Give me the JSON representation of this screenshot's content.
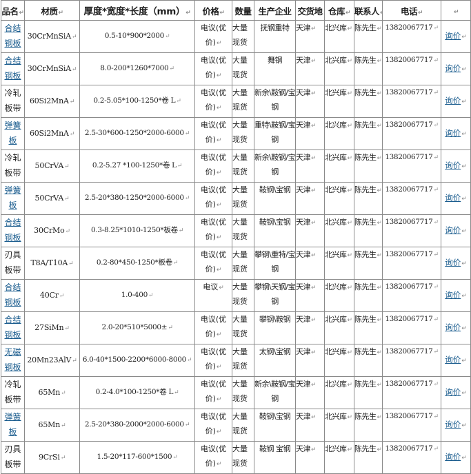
{
  "headers": {
    "name": "品名",
    "material": "材质",
    "size": "厚度*宽度*长度（mm）",
    "price": "价格",
    "qty": "数量",
    "maker": "生产企业",
    "place": "交货地",
    "warehouse": "仓库",
    "contact": "联系人",
    "phone": "电话"
  },
  "rows": [
    {
      "name": "合结钢板",
      "link": true,
      "material": "30CrMnSiA",
      "size": "0.5-10*900*2000",
      "price": "电议(优价)",
      "qty": "大量现货",
      "maker": "抚钢重特",
      "place": "天津",
      "warehouse": "北兴库",
      "contact": "陈先生",
      "phone": "13820067717",
      "inquiry": "询价"
    },
    {
      "name": "合结钢板",
      "link": true,
      "material": "30CrMnSiA",
      "size": "8.0-200*1260*7000",
      "price": "电议(优价)",
      "qty": "大量现货",
      "maker": "舞钢",
      "place": "天津",
      "warehouse": "北兴库",
      "contact": "陈先生",
      "phone": "13820067717",
      "inquiry": "询价"
    },
    {
      "name": "冷轧板带",
      "link": false,
      "material": "60Si2MnA",
      "size": "0.2-5.05*100-1250*卷 L",
      "price": "电议(优价)",
      "qty": "大量现货",
      "maker": "新余\\鞍钢/宝钢",
      "place": "天津",
      "warehouse": "北兴库",
      "contact": "陈先生",
      "phone": "13820067717",
      "inquiry": "询价"
    },
    {
      "name": "弹簧板",
      "link": true,
      "material": "60Si2MnA",
      "size": "2.5-30*600-1250*2000-6000",
      "price": "电议(优价)",
      "qty": "大量现货",
      "maker": "重特\\鞍钢/宝钢",
      "place": "天津",
      "warehouse": "北兴库",
      "contact": "陈先生",
      "phone": "13820067717",
      "inquiry": "询价"
    },
    {
      "name": "冷轧板带",
      "link": false,
      "material": "50CrVA",
      "size": "0.2-5.27 *100-1250*卷 L",
      "price": "电议(优价)",
      "qty": "大量现货",
      "maker": "新余\\鞍钢/宝钢",
      "place": "天津",
      "warehouse": "北兴库",
      "contact": "陈先生",
      "phone": "13820067717",
      "inquiry": "询价"
    },
    {
      "name": "弹簧板",
      "link": true,
      "material": "50CrVA",
      "size": "2.5-20*380-1250*2000-6000",
      "price": "电议(优价)",
      "qty": "大量现货",
      "maker": "鞍钢\\宝钢",
      "place": "天津",
      "warehouse": "北兴库",
      "contact": "陈先生",
      "phone": "13820067717",
      "inquiry": "询价"
    },
    {
      "name": "合结钢板",
      "link": true,
      "material": "30CrMo",
      "size": "0.3-8.25*1010-1250*板卷",
      "price": "电议(优价)",
      "qty": "大量现货",
      "maker": "鞍钢\\宝钢",
      "place": "天津",
      "warehouse": "北兴库",
      "contact": "陈先生",
      "phone": "13820067717",
      "inquiry": "询价"
    },
    {
      "name": "刃具板带",
      "link": false,
      "material": "T8A/T10A",
      "size": "0.2-80*450-1250*板卷",
      "price": "电议(优价)",
      "qty": "大量现货",
      "maker": "攀钢\\重特/宝钢",
      "place": "天津",
      "warehouse": "北兴库",
      "contact": "陈先生",
      "phone": "13820067717",
      "inquiry": "询价"
    },
    {
      "name": "合结钢板",
      "link": true,
      "material": "40Cr",
      "size": "1.0-400",
      "price": "电议",
      "qty": "大量现货",
      "maker": "攀钢\\天钢/宝钢",
      "place": "天津",
      "warehouse": "北兴库",
      "contact": "陈先生",
      "phone": "13820067717",
      "inquiry": "询价"
    },
    {
      "name": "合结钢板",
      "link": true,
      "material": "27SiMn",
      "size": "2.0-20*510*5000±",
      "price": "电议(优价)",
      "qty": "大量现货",
      "maker": "攀钢\\鞍钢",
      "place": "天津",
      "warehouse": "北兴库",
      "contact": "陈先生",
      "phone": "13820067717",
      "inquiry": "询价"
    },
    {
      "name": "无磁钢板",
      "link": true,
      "material": "20Mn23AlV",
      "size": "6.0-40*1500-2200*6000-8000",
      "price": "电议(优价)",
      "qty": "大量现货",
      "maker": "太钢\\宝钢",
      "place": "天津",
      "warehouse": "北兴库",
      "contact": "陈先生",
      "phone": "13820067717",
      "inquiry": "询价"
    },
    {
      "name": "冷轧板带",
      "link": false,
      "material": "65Mn",
      "size": "0.2-4.0*100-1250*卷 L",
      "price": "电议(优价)",
      "qty": "大量现货",
      "maker": "新余\\鞍钢/宝钢",
      "place": "天津",
      "warehouse": "北兴库",
      "contact": "陈先生",
      "phone": "13820067717",
      "inquiry": "询价"
    },
    {
      "name": "弹簧板",
      "link": true,
      "material": "65Mn",
      "size": "2.5-20*380-2000*2000-6000",
      "price": "电议(优价)",
      "qty": "大量现货",
      "maker": "鞍钢\\宝钢",
      "place": "天津",
      "warehouse": "北兴库",
      "contact": "陈先生",
      "phone": "13820067717",
      "inquiry": "询价"
    },
    {
      "name": "刃具板带",
      "link": false,
      "material": "9CrSi",
      "size": "1.5-20*117-600*1500",
      "price": "电议(优价)",
      "qty": "大量现货",
      "maker": "鞍钢 宝钢",
      "place": "天津",
      "warehouse": "北兴库",
      "contact": "陈先生",
      "phone": "13820067717",
      "inquiry": "询价"
    }
  ],
  "cell_mark": "↵",
  "colors": {
    "link": "#1a5c8e",
    "border": "#8a8a8a",
    "text": "#222222"
  }
}
